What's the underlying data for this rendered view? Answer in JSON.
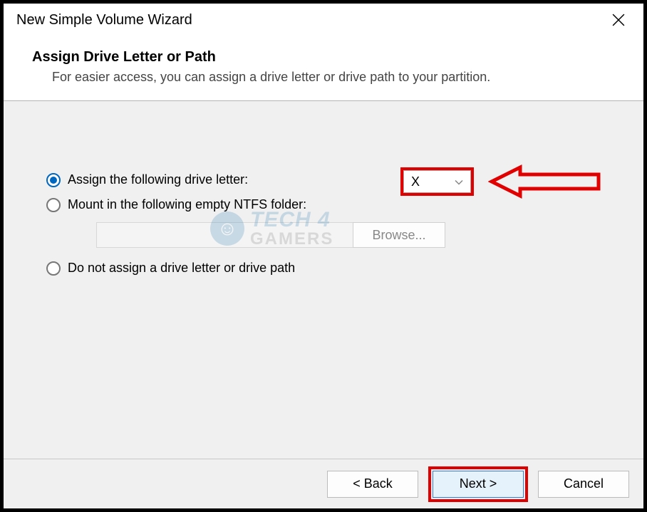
{
  "window": {
    "title": "New Simple Volume Wizard"
  },
  "header": {
    "title": "Assign Drive Letter or Path",
    "subtitle": "For easier access, you can assign a drive letter or drive path to your partition."
  },
  "options": {
    "assign_letter": {
      "label": "Assign the following drive letter:",
      "selected_value": "X"
    },
    "mount_folder": {
      "label": "Mount in the following empty NTFS folder:",
      "path_value": "",
      "browse_label": "Browse..."
    },
    "no_assign": {
      "label": "Do not assign a drive letter or drive path"
    }
  },
  "footer": {
    "back_label": "< Back",
    "next_label": "Next >",
    "cancel_label": "Cancel"
  },
  "watermark": {
    "line1": "TECH 4",
    "line2": "GAMERS"
  },
  "annotations": {
    "highlight_color": "#e10000"
  }
}
